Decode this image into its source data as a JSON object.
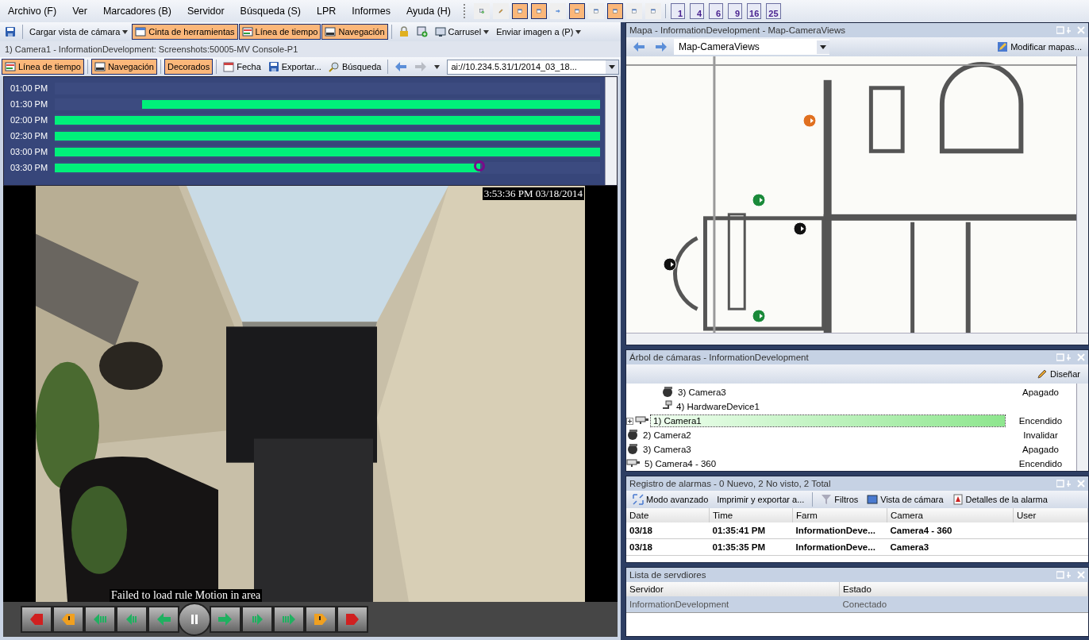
{
  "menu": [
    "Archivo (F)",
    "Ver",
    "Marcadores (B)",
    "Servidor",
    "Búsqueda (S)",
    "LPR",
    "Informes",
    "Ayuda (H)"
  ],
  "layout_toolbar": {
    "tools": [
      {
        "on": false
      },
      {
        "on": false
      },
      {
        "on": true
      },
      {
        "on": true
      },
      {
        "on": false
      },
      {
        "on": true
      },
      {
        "on": false
      },
      {
        "on": true
      },
      {
        "on": false
      },
      {
        "on": false
      }
    ],
    "grid_buttons": [
      "1",
      "4",
      "6",
      "9",
      "16",
      "25"
    ]
  },
  "main_toolbar": [
    {
      "kind": "save"
    },
    {
      "kind": "dropdown",
      "label": "Cargar vista de cámara"
    },
    {
      "kind": "toggle",
      "label": "Cinta de herramientas",
      "on": true
    },
    {
      "kind": "toggle",
      "label": "Línea de tiempo",
      "on": true
    },
    {
      "kind": "toggle",
      "label": "Navegación",
      "on": true
    },
    {
      "kind": "lock"
    },
    {
      "kind": "add"
    },
    {
      "kind": "dropdown",
      "label": "Carrusel"
    },
    {
      "kind": "dropdown",
      "label": "Enviar imagen a (P)"
    }
  ],
  "camera_panel": {
    "title": "1) Camera1 - InformationDevelopment: Screenshots:50005-MV Console-P1",
    "toolbar": [
      {
        "kind": "toggle",
        "label": "Línea de tiempo",
        "on": true
      },
      {
        "kind": "toggle",
        "label": "Navegación",
        "on": true
      },
      {
        "kind": "toggle",
        "label": "Decorados",
        "on": true
      },
      {
        "kind": "button",
        "label": "Fecha"
      },
      {
        "kind": "button",
        "label": "Exportar..."
      },
      {
        "kind": "button",
        "label": "Búsqueda"
      },
      {
        "kind": "nav"
      }
    ],
    "address": "ai://10.234.5.31/1/2014_03_18...",
    "timeline": [
      {
        "time": "01:00 PM",
        "kind": "head",
        "playhead": false
      },
      {
        "time": "01:30 PM",
        "level": 0.84,
        "kind": "tail",
        "playhead": false
      },
      {
        "time": "02:00 PM",
        "level": 1,
        "kind": "head",
        "playhead": false
      },
      {
        "time": "02:30 PM",
        "level": 1,
        "kind": "head",
        "playhead": false
      },
      {
        "time": "03:00 PM",
        "level": 1,
        "kind": "head",
        "playhead": false
      },
      {
        "time": "03:30 PM",
        "level": 0.78,
        "kind": "head",
        "playhead": true
      }
    ],
    "video": {
      "timestamp": "3:53:36 PM 03/18/2014",
      "message": "Failed to load rule Motion in area"
    }
  },
  "map_panel": {
    "title": "Mapa - InformationDevelopment - Map-CameraViews",
    "map_select": "Map-CameraViews",
    "edit_button": "Modificar mapas..."
  },
  "tree_panel": {
    "title": "Árbol de cámaras - InformationDevelopment",
    "design_button": "Diseñar",
    "items": [
      {
        "children": [
          {
            "children": [
              {
                "label": "3) Camera3",
                "kind": "dome",
                "status": "Apagado",
                "selected": false
              },
              {
                "label": "4) HardwareDevice1",
                "kind": "device",
                "selected": false
              }
            ]
          }
        ]
      },
      {
        "label": "1) Camera1",
        "kind": "box",
        "status": "Encendido",
        "selected": true,
        "expanded": false
      },
      {
        "label": "2) Camera2",
        "kind": "dome",
        "status": "Invalidar",
        "selected": false
      },
      {
        "label": "3) Camera3",
        "kind": "dome",
        "status": "Apagado",
        "selected": false
      },
      {
        "label": "5) Camera4 - 360",
        "kind": "box",
        "status": "Encendido",
        "selected": false
      }
    ]
  },
  "alarm_panel": {
    "title": "Registro de alarmas - 0 Nuevo, 2 No visto, 2 Total",
    "toolbar": [
      "Modo avanzado",
      "Imprimir y exportar a...",
      "Filtros",
      "Vista de cámara",
      "Detalles de la alarma"
    ],
    "columns": [
      "Date",
      "Time",
      "Farm",
      "Camera",
      "User"
    ],
    "rows": [
      [
        "03/18",
        "01:35:41 PM",
        "InformationDeve...",
        "Camera4 - 360"
      ],
      [
        "03/18",
        "01:35:35 PM",
        "InformationDeve...",
        "Camera3"
      ]
    ]
  },
  "server_panel": {
    "title": "Lista de servdiores",
    "columns": [
      "Servidor",
      "Estado"
    ],
    "rows": [
      [
        "InformationDevelopment",
        "Conectado"
      ]
    ]
  }
}
